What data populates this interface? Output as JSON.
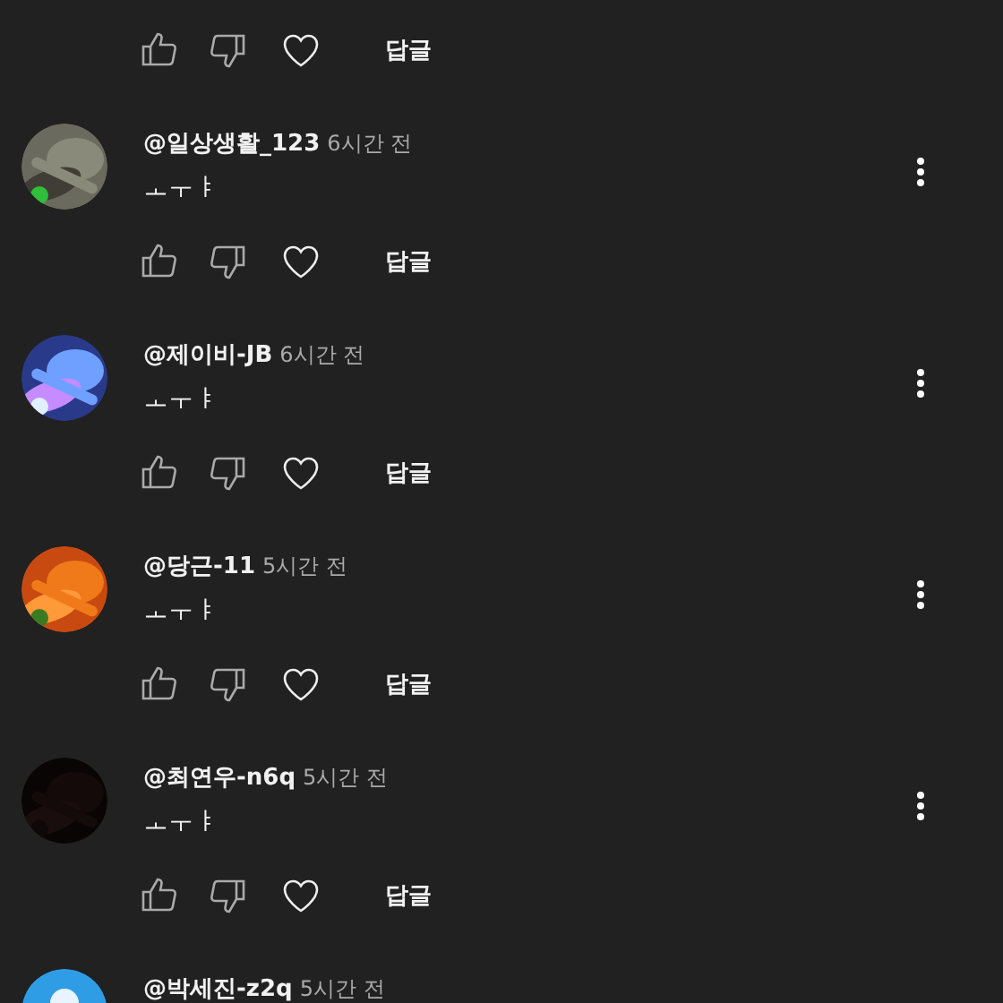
{
  "top_actions": {
    "reply": "답글"
  },
  "comments": [
    {
      "author": "@일상생활_123",
      "time": "6시간 전",
      "text": "ㅗㅜㅑ",
      "menu": true,
      "reply": "답글"
    },
    {
      "author": "@제이비-JB",
      "time": "6시간 전",
      "text": "ㅗㅜㅑ",
      "menu": true,
      "reply": "답글"
    },
    {
      "author": "@당근-11",
      "time": "5시간 전",
      "text": "ㅗㅜㅑ",
      "menu": true,
      "reply": "답글"
    },
    {
      "author": "@최연우-n6q",
      "time": "5시간 전",
      "text": "ㅗㅜㅑ",
      "menu": true,
      "reply": "답글"
    },
    {
      "avatar": {
        "kind": "default"
      },
      "author": "@박세진-z2q",
      "time": "5시간 전",
      "menu": false
    }
  ]
}
